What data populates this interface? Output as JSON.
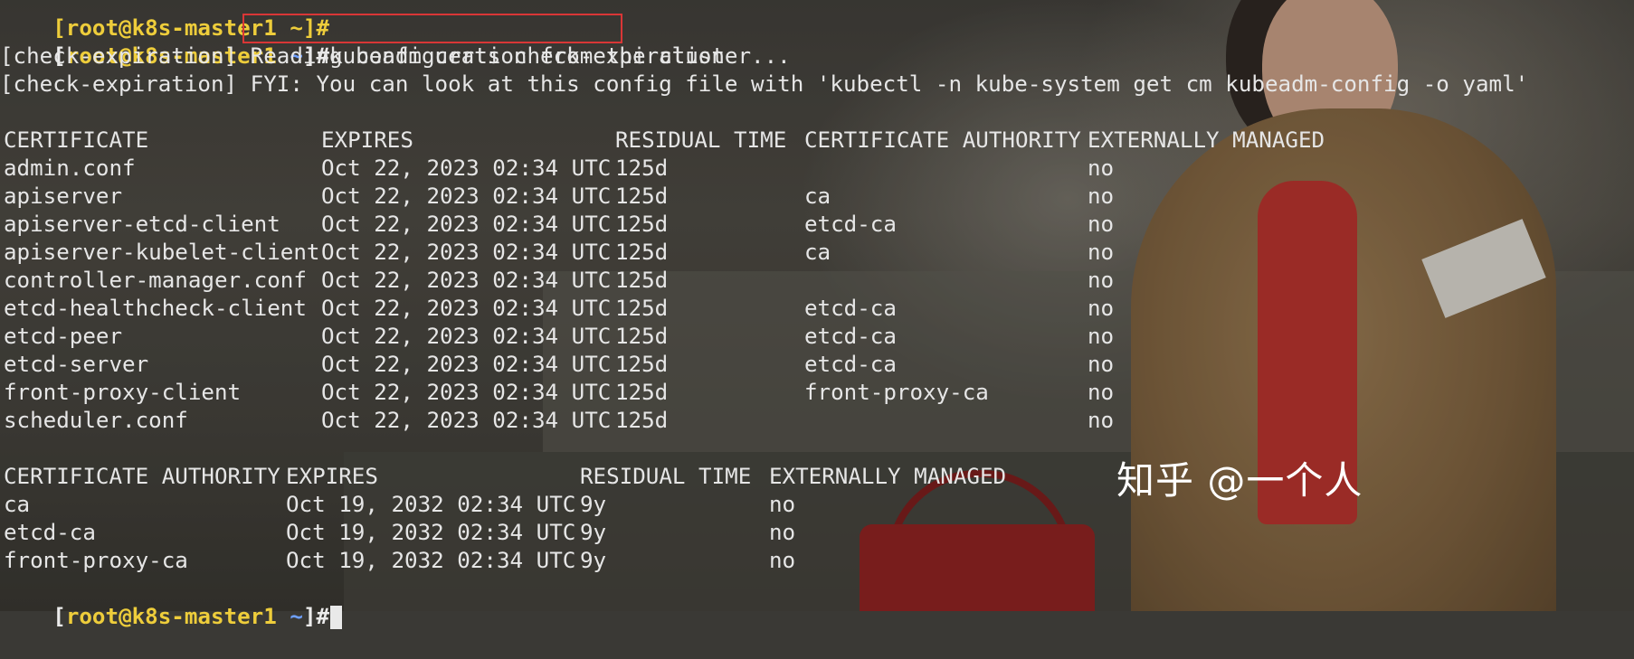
{
  "terminal": {
    "top_partial": "[root@k8s-master1 ~]#",
    "prompt": {
      "open": "[",
      "user": "root",
      "at": "@",
      "host": "k8s-master1",
      "dir": "~",
      "close": "]#"
    },
    "command": "kubeadm certs check-expiration",
    "info_lines": [
      "[check-expiration] Reading configuration from the cluster...",
      "[check-expiration] FYI: You can look at this config file with 'kubectl -n kube-system get cm kubeadm-config -o yaml'"
    ],
    "certificates": {
      "headers": [
        "CERTIFICATE",
        "EXPIRES",
        "RESIDUAL TIME",
        "CERTIFICATE AUTHORITY",
        "EXTERNALLY MANAGED"
      ],
      "rows": [
        [
          "admin.conf",
          "Oct 22, 2023 02:34 UTC",
          "125d",
          "",
          "no"
        ],
        [
          "apiserver",
          "Oct 22, 2023 02:34 UTC",
          "125d",
          "ca",
          "no"
        ],
        [
          "apiserver-etcd-client",
          "Oct 22, 2023 02:34 UTC",
          "125d",
          "etcd-ca",
          "no"
        ],
        [
          "apiserver-kubelet-client",
          "Oct 22, 2023 02:34 UTC",
          "125d",
          "ca",
          "no"
        ],
        [
          "controller-manager.conf",
          "Oct 22, 2023 02:34 UTC",
          "125d",
          "",
          "no"
        ],
        [
          "etcd-healthcheck-client",
          "Oct 22, 2023 02:34 UTC",
          "125d",
          "etcd-ca",
          "no"
        ],
        [
          "etcd-peer",
          "Oct 22, 2023 02:34 UTC",
          "125d",
          "etcd-ca",
          "no"
        ],
        [
          "etcd-server",
          "Oct 22, 2023 02:34 UTC",
          "125d",
          "etcd-ca",
          "no"
        ],
        [
          "front-proxy-client",
          "Oct 22, 2023 02:34 UTC",
          "125d",
          "front-proxy-ca",
          "no"
        ],
        [
          "scheduler.conf",
          "Oct 22, 2023 02:34 UTC",
          "125d",
          "",
          "no"
        ]
      ]
    },
    "authorities": {
      "headers": [
        "CERTIFICATE AUTHORITY",
        "EXPIRES",
        "RESIDUAL TIME",
        "EXTERNALLY MANAGED"
      ],
      "rows": [
        [
          "ca",
          "Oct 19, 2032 02:34 UTC",
          "9y",
          "no"
        ],
        [
          "etcd-ca",
          "Oct 19, 2032 02:34 UTC",
          "9y",
          "no"
        ],
        [
          "front-proxy-ca",
          "Oct 19, 2032 02:34 UTC",
          "9y",
          "no"
        ]
      ]
    },
    "colors": {
      "text": "#e6e6e6",
      "user_host": "#eecd3b",
      "dir": "#6ea0ff",
      "highlight_box": "#d93636"
    }
  },
  "watermark": "知乎 @一个人"
}
